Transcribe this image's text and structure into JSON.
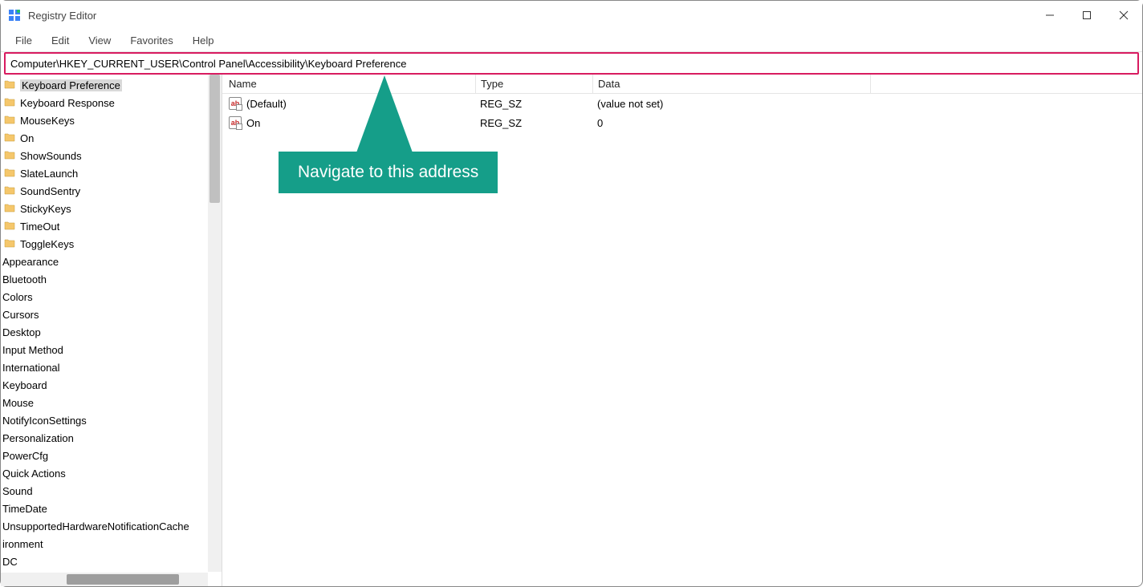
{
  "window": {
    "title": "Registry Editor"
  },
  "menu": {
    "file": "File",
    "edit": "Edit",
    "view": "View",
    "favorites": "Favorites",
    "help": "Help"
  },
  "address": "Computer\\HKEY_CURRENT_USER\\Control Panel\\Accessibility\\Keyboard Preference",
  "tree": {
    "items": [
      {
        "label": "Keyboard Preference",
        "icon": true,
        "selected": true
      },
      {
        "label": "Keyboard Response",
        "icon": true
      },
      {
        "label": "MouseKeys",
        "icon": true
      },
      {
        "label": "On",
        "icon": true
      },
      {
        "label": "ShowSounds",
        "icon": true
      },
      {
        "label": "SlateLaunch",
        "icon": true
      },
      {
        "label": "SoundSentry",
        "icon": true
      },
      {
        "label": "StickyKeys",
        "icon": true
      },
      {
        "label": "TimeOut",
        "icon": true
      },
      {
        "label": "ToggleKeys",
        "icon": true
      },
      {
        "label": "Appearance",
        "icon": false
      },
      {
        "label": "Bluetooth",
        "icon": false
      },
      {
        "label": "Colors",
        "icon": false
      },
      {
        "label": "Cursors",
        "icon": false
      },
      {
        "label": "Desktop",
        "icon": false
      },
      {
        "label": "Input Method",
        "icon": false
      },
      {
        "label": "International",
        "icon": false
      },
      {
        "label": "Keyboard",
        "icon": false
      },
      {
        "label": "Mouse",
        "icon": false
      },
      {
        "label": "NotifyIconSettings",
        "icon": false
      },
      {
        "label": "Personalization",
        "icon": false
      },
      {
        "label": "PowerCfg",
        "icon": false
      },
      {
        "label": "Quick Actions",
        "icon": false
      },
      {
        "label": "Sound",
        "icon": false
      },
      {
        "label": "TimeDate",
        "icon": false
      },
      {
        "label": "UnsupportedHardwareNotificationCache",
        "icon": false
      },
      {
        "label": "ironment",
        "icon": false
      },
      {
        "label": "DC",
        "icon": false
      }
    ]
  },
  "columns": {
    "name": "Name",
    "type": "Type",
    "data": "Data"
  },
  "rows": [
    {
      "name": "(Default)",
      "type": "REG_SZ",
      "data": "(value not set)"
    },
    {
      "name": "On",
      "type": "REG_SZ",
      "data": "0"
    }
  ],
  "callout": {
    "text": "Navigate to this address"
  }
}
